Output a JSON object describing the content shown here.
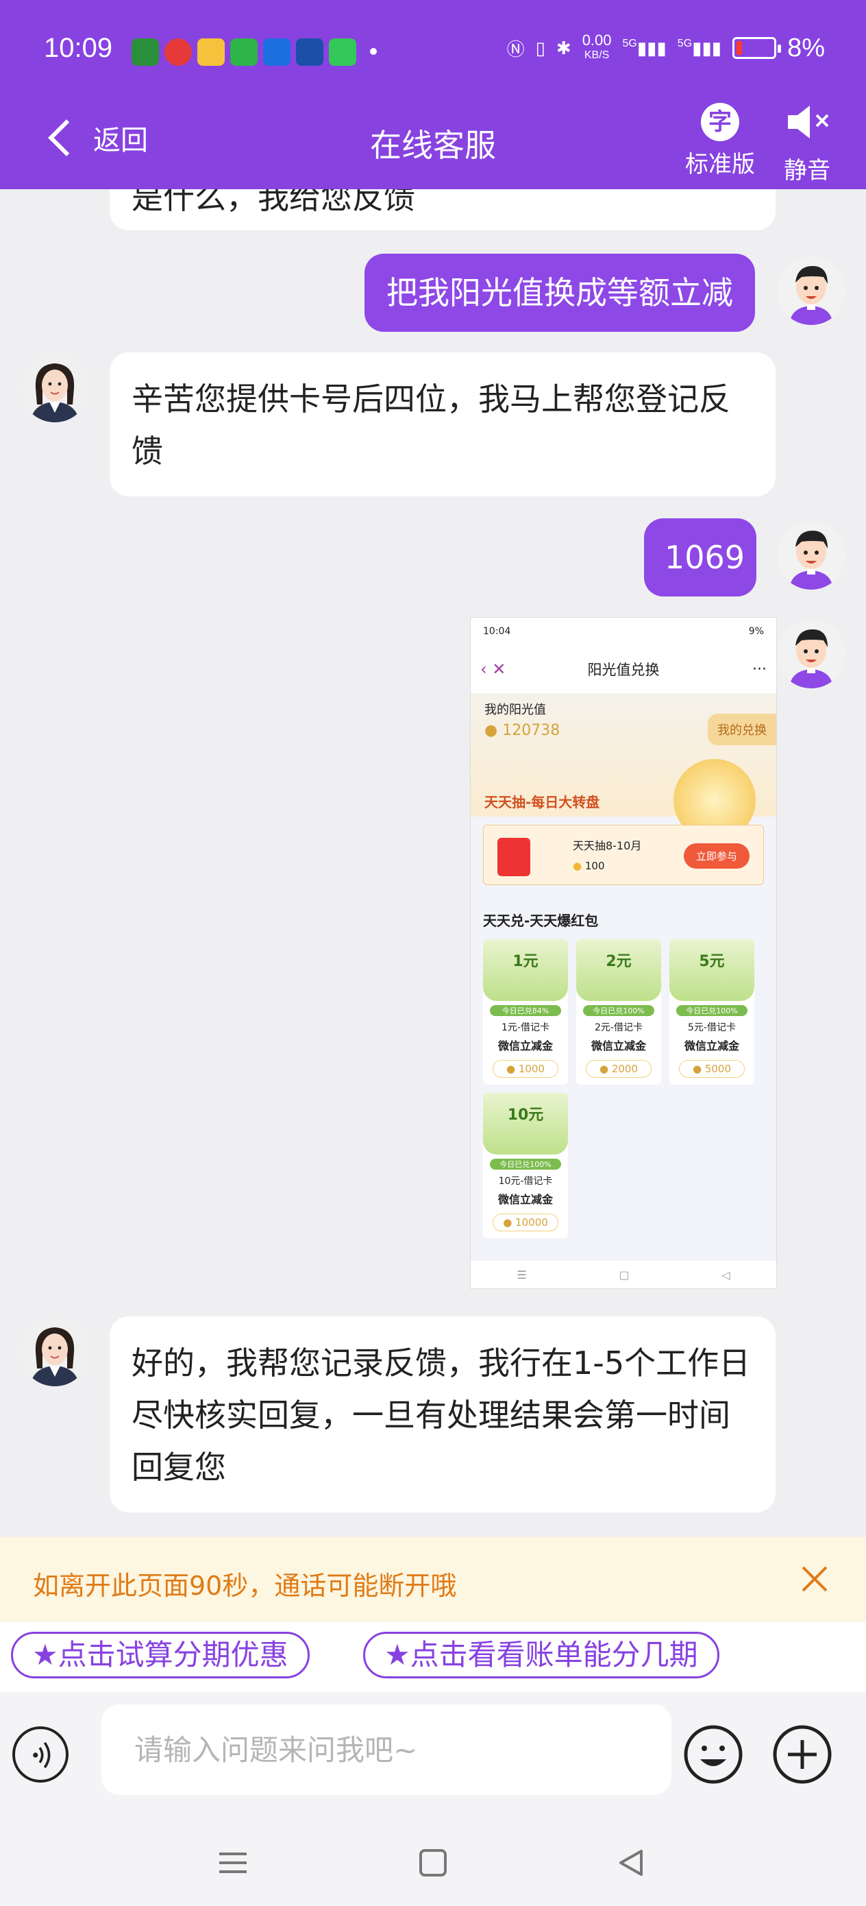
{
  "status": {
    "time": "10:09",
    "net_speed_top": "0.00",
    "net_speed_bottom": "KB/S",
    "sig1": "5G",
    "sig2": "5G",
    "battery": "8%"
  },
  "header": {
    "back_label": "返回",
    "title": "在线客服",
    "tool1_icon_char": "字",
    "tool1_label": "标准版",
    "tool2_label": "静音"
  },
  "messages": [
    {
      "role": "agent",
      "text": "是什么，我给您反馈"
    },
    {
      "role": "user",
      "text": "把我阳光值换成等额立减"
    },
    {
      "role": "agent",
      "text": "辛苦您提供卡号后四位，我马上帮您登记反馈"
    },
    {
      "role": "user",
      "text": "1069"
    },
    {
      "role": "agent",
      "text": "好的，我帮您记录反馈，我行在1-5个工作日尽快核实回复，一旦有处理结果会第一时间回复您"
    }
  ],
  "screenshot": {
    "status_time": "10:04",
    "status_battery": "9%",
    "nav_title": "阳光值兑换",
    "nav_more": "···",
    "balance_label": "我的阳光值",
    "balance_value": "120738",
    "my_exchange": "我的兑换",
    "lottery_banner": "天天抽-每日大转盘",
    "draw_title": "天天抽8-10月",
    "draw_cost": "100",
    "draw_button": "立即参与",
    "section_title": "天天兑-天天爆红包",
    "cards": [
      {
        "amount": "1元",
        "tag": "今日已兑84%",
        "line1": "1元-借记卡",
        "line2": "微信立减金",
        "cost": "1000"
      },
      {
        "amount": "2元",
        "tag": "今日已兑100%",
        "line1": "2元-借记卡",
        "line2": "微信立减金",
        "cost": "2000"
      },
      {
        "amount": "5元",
        "tag": "今日已兑100%",
        "line1": "5元-借记卡",
        "line2": "微信立减金",
        "cost": "5000"
      },
      {
        "amount": "10元",
        "tag": "今日已兑100%",
        "line1": "10元-借记卡",
        "line2": "微信立减金",
        "cost": "10000"
      }
    ]
  },
  "notice": {
    "text": "如离开此页面90秒，通话可能断开哦"
  },
  "quick_actions": [
    "★点击试算分期优惠",
    "★点击看看账单能分几期"
  ],
  "input": {
    "placeholder": "请输入问题来问我吧~"
  },
  "colors": {
    "brand": "#8742e0",
    "notice_text": "#e07b17"
  }
}
